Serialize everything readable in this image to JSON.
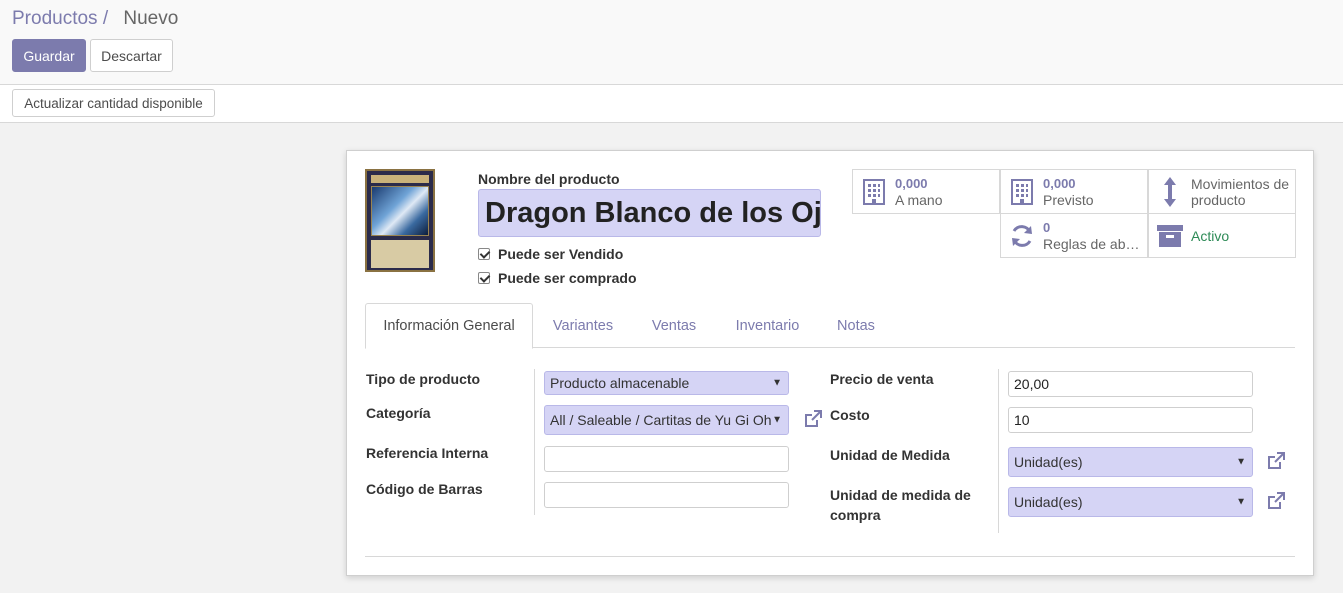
{
  "breadcrumb": {
    "parent": "Productos",
    "separator": "/",
    "current": "Nuevo"
  },
  "buttons": {
    "save": "Guardar",
    "discard": "Descartar",
    "update_qty": "Actualizar cantidad disponible"
  },
  "product": {
    "name_label": "Nombre del producto",
    "name_value": "Dragon Blanco de los Ojos Azules",
    "can_be_sold": "Puede ser Vendido",
    "can_be_purchased": "Puede ser comprado"
  },
  "stats": {
    "on_hand": {
      "value": "0,000",
      "label": "A mano"
    },
    "forecast": {
      "value": "0,000",
      "label": "Previsto"
    },
    "moves": {
      "label": "Movimientos de producto"
    },
    "reorder": {
      "value": "0",
      "label": "Reglas de abastecimiento"
    },
    "active": {
      "label": "Activo"
    }
  },
  "tabs": [
    "Información General",
    "Variantes",
    "Ventas",
    "Inventario",
    "Notas"
  ],
  "form_left": {
    "type_label": "Tipo de producto",
    "type_value": "Producto almacenable",
    "category_label": "Categoría",
    "category_value": "All / Saleable / Cartitas de Yu Gi Oh",
    "ref_label": "Referencia Interna",
    "ref_value": "",
    "barcode_label": "Código de Barras",
    "barcode_value": ""
  },
  "form_right": {
    "price_label": "Precio de venta",
    "price_value": "20,00",
    "cost_label": "Costo",
    "cost_value": "10",
    "uom_label": "Unidad de Medida",
    "uom_value": "Unidad(es)",
    "po_uom_label": "Unidad de medida de compra",
    "po_uom_value": "Unidad(es)"
  },
  "colors": {
    "brand": "#7c7bad",
    "required_bg": "#d5d4f5",
    "active_green": "#2e8b57"
  }
}
